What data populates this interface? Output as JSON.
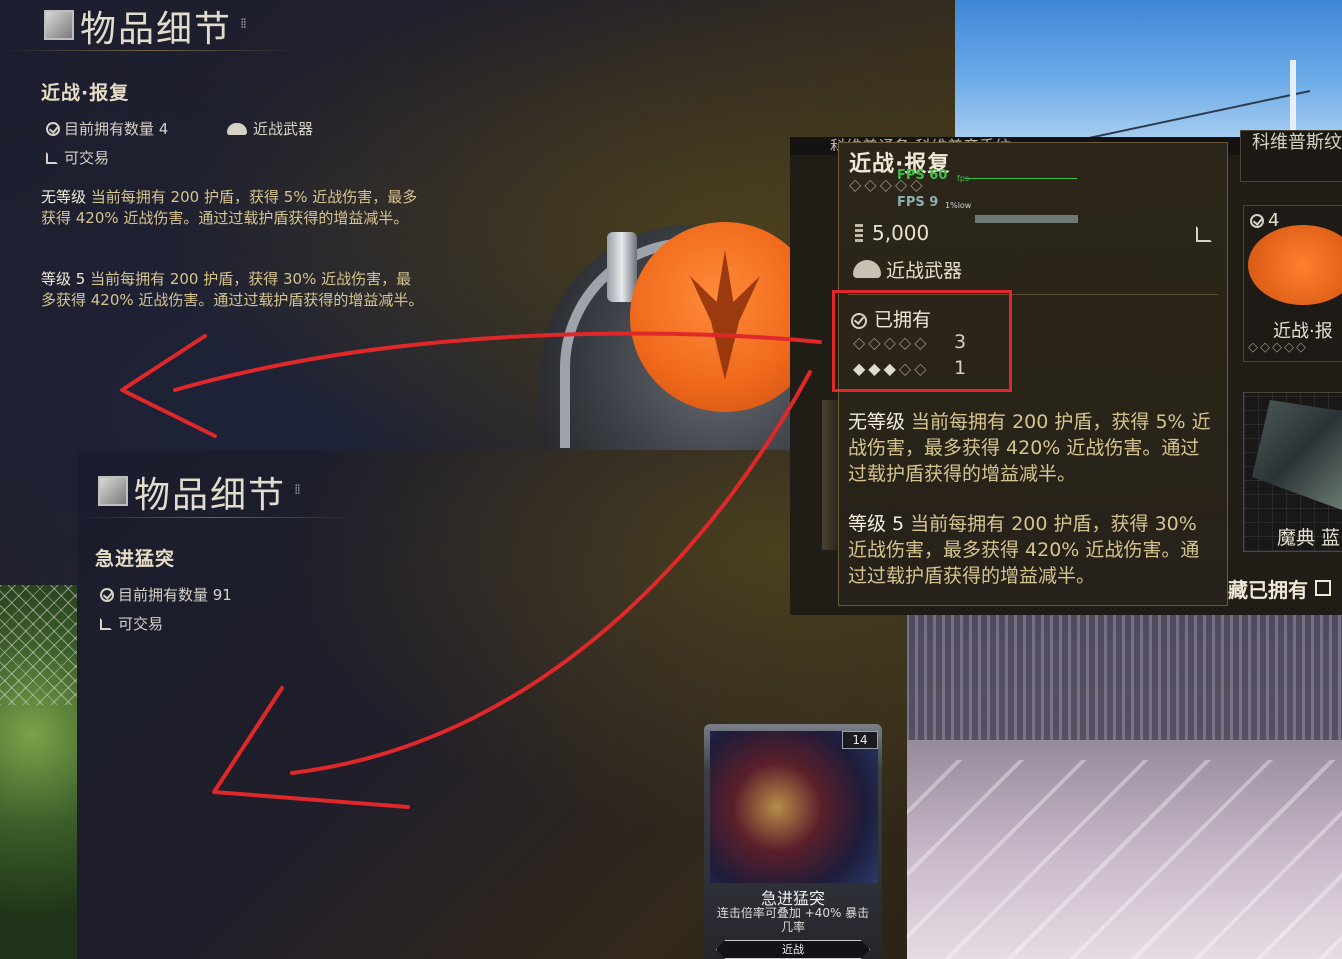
{
  "panel_top": {
    "header_title": "物品细节",
    "item_name": "近战·报复",
    "owned_count": "目前拥有数量 4",
    "category": "近战武器",
    "tradeable": "可交易",
    "desc_unranked_label": "无等级",
    "desc_unranked_text": " 当前每拥有 200 护盾，获得 5% 近战伤害，最多获得 420% 近战伤害。通过过载护盾获得的增益减半。",
    "desc_rank5_label": "等级 5",
    "desc_rank5_text": " 当前每拥有 200 护盾，获得 30% 近战伤害，最多获得 420% 近战伤害。通过过载护盾获得的增益减半。"
  },
  "panel_bottom": {
    "header_title": "物品细节",
    "item_name": "急进猛突",
    "owned_count": "目前拥有数量 91",
    "tradeable": "可交易"
  },
  "popup": {
    "title": "近战·报复",
    "rank_stars": "◇◇◇◇◇",
    "fps_main": "FPS 60",
    "fps_main_unit": "fps",
    "fps_low": "FPS 9",
    "fps_low_unit": "1%low",
    "price": "5,000",
    "category": "近战武器",
    "owned_label": "已拥有",
    "rank_rows": [
      {
        "filled": "",
        "empty": "◇◇◇◇◇",
        "count": "3"
      },
      {
        "filled": "◆◆◆",
        "empty": "◇◇",
        "count": "1"
      }
    ],
    "desc_unranked_label": "无等级",
    "desc_unranked_text": " 当前每拥有 200 护盾，获得 5% 近战伤害，最多获得 420% 近战伤害。通过过载护盾获得的增益减半。",
    "desc_rank5_label": "等级 5",
    "desc_rank5_text": " 当前每拥有 200 护盾，获得 30% 近战伤害，最多获得 420% 近战伤害。通过过载护盾获得的增益减半。",
    "top_strip_text": "科维普诵备   科维普彦秀纹"
  },
  "right_cards": {
    "card0_text": "科维普斯纹章",
    "card1_count": "4",
    "card1_label": "近战·报",
    "card1_stars": "◇◇◇◇◇",
    "card2_label": "魔典 蓝",
    "owned_filter": "藏已拥有"
  },
  "mod_card": {
    "cost": "14",
    "name": "急进猛突",
    "desc": "连击倍率可叠加 +40% 暴击几率",
    "type": "近战"
  },
  "colors": {
    "accent_gold": "#d6c48e",
    "highlight_red": "#e0272a",
    "emblem_orange": "#f06a1c"
  }
}
